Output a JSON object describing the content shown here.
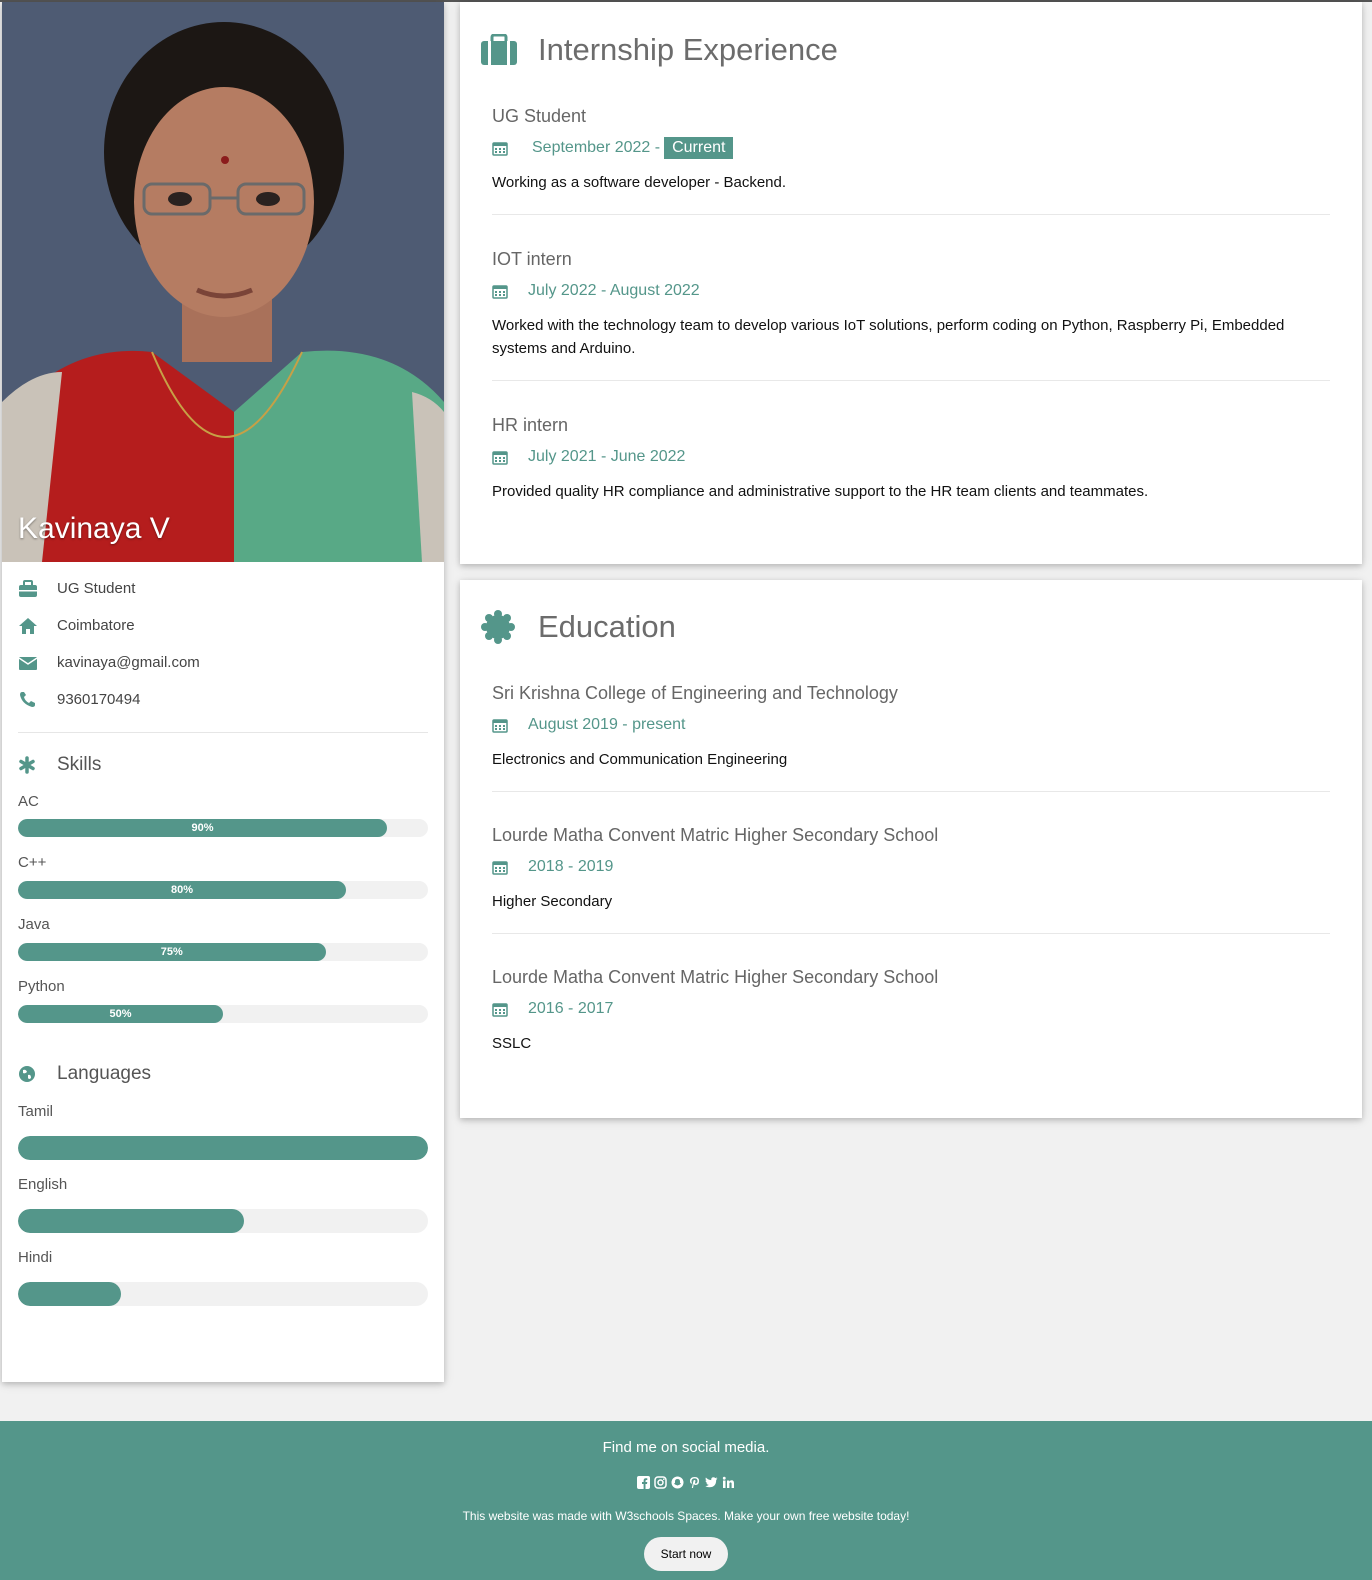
{
  "profile": {
    "name": "Kavinaya V",
    "role": "UG Student",
    "location": "Coimbatore",
    "email": "kavinaya@gmail.com",
    "phone": "9360170494"
  },
  "skills": {
    "heading": "Skills",
    "items": [
      {
        "label": "AC",
        "percent_label": "90%",
        "level": 90
      },
      {
        "label": "C++",
        "percent_label": "80%",
        "level": 80
      },
      {
        "label": "Java",
        "percent_label": "75%",
        "level": 75
      },
      {
        "label": "Python",
        "percent_label": "50%",
        "level": 50
      }
    ]
  },
  "languages": {
    "heading": "Languages",
    "items": [
      {
        "label": "Tamil",
        "level": 100
      },
      {
        "label": "English",
        "level": 55
      },
      {
        "label": "Hindi",
        "level": 25
      }
    ]
  },
  "experience": {
    "heading": "Internship Experience",
    "entries": [
      {
        "title": "UG Student",
        "date": "September 2022 -",
        "badge": "Current",
        "desc": "Working as a software developer - Backend."
      },
      {
        "title": "IOT intern",
        "date": "July 2022 - August 2022",
        "desc": "Worked with the technology team to develop various IoT solutions, perform coding on Python, Raspberry Pi, Embedded systems and Arduino."
      },
      {
        "title": "HR intern",
        "date": "July 2021 - June 2022",
        "desc": "Provided quality HR compliance and administrative support to the HR team clients and teammates."
      }
    ]
  },
  "education": {
    "heading": "Education",
    "entries": [
      {
        "title": "Sri Krishna College of Engineering and Technology",
        "date": "August 2019 - present",
        "desc": "Electronics and Communication Engineering"
      },
      {
        "title": "Lourde Matha Convent Matric Higher Secondary School",
        "date": "2018 - 2019",
        "desc": "Higher Secondary"
      },
      {
        "title": "Lourde Matha Convent Matric Higher Secondary School",
        "date": "2016 - 2017",
        "desc": "SSLC"
      }
    ]
  },
  "footer": {
    "heading": "Find me on social media.",
    "social_icons": [
      "facebook-icon",
      "instagram-icon",
      "snapchat-icon",
      "pinterest-icon",
      "twitter-icon",
      "linkedin-icon"
    ],
    "note": "This website was made with W3schools Spaces. Make your own free website today!",
    "button": "Start now"
  },
  "colors": {
    "accent": "#54968a",
    "background": "#f1f1f1"
  }
}
